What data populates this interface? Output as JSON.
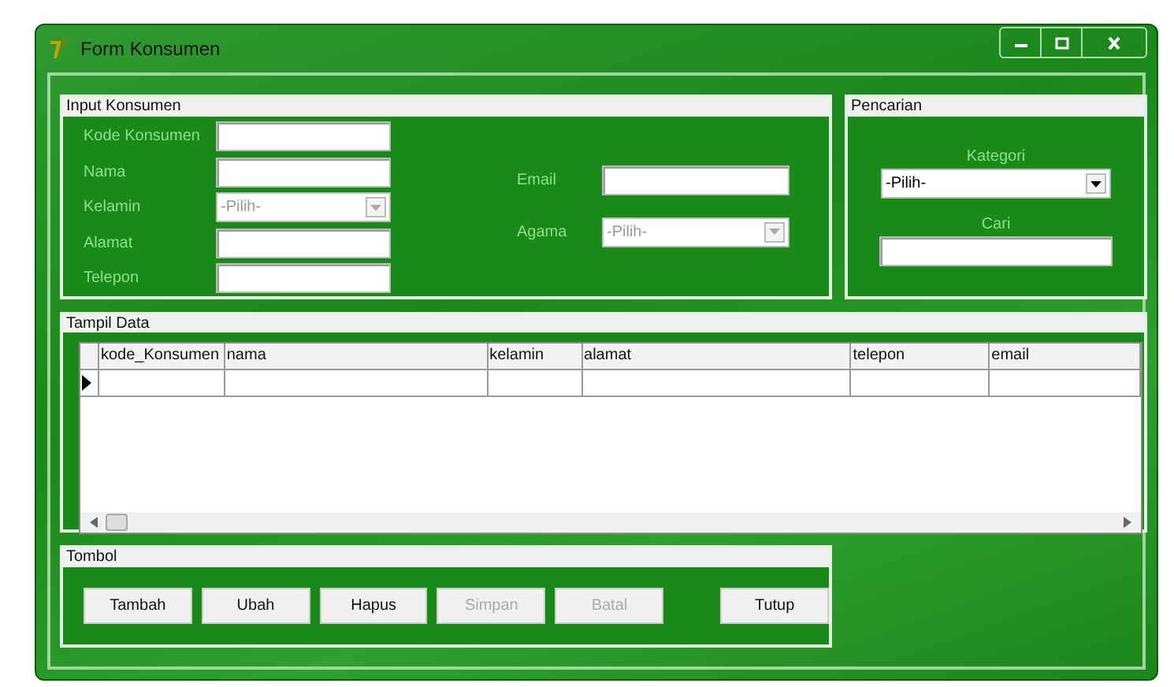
{
  "window": {
    "title": "Form Konsumen"
  },
  "input_group": {
    "title": "Input Konsumen",
    "left_fields": [
      {
        "label": "Kode Konsumen",
        "kind": "text"
      },
      {
        "label": "Nama",
        "kind": "text"
      },
      {
        "label": "Kelamin",
        "kind": "combo",
        "value": "-Pilih-",
        "disabled": true
      },
      {
        "label": "Alamat",
        "kind": "text"
      },
      {
        "label": "Telepon",
        "kind": "text"
      }
    ],
    "right_fields": [
      {
        "label": "Email",
        "kind": "text"
      },
      {
        "label": "Agama",
        "kind": "combo",
        "value": "-Pilih-",
        "disabled": true
      }
    ]
  },
  "search_group": {
    "title": "Pencarian",
    "category_label": "Kategori",
    "category_value": "-Pilih-",
    "search_label": "Cari"
  },
  "data_group": {
    "title": "Tampil Data",
    "columns": [
      "kode_Konsumen",
      "nama",
      "kelamin",
      "alamat",
      "telepon",
      "email"
    ],
    "rows": [
      {
        "current": true
      }
    ]
  },
  "button_group": {
    "title": "Tombol",
    "buttons": [
      {
        "label": "Tambah",
        "disabled": false
      },
      {
        "label": "Ubah",
        "disabled": false
      },
      {
        "label": "Hapus",
        "disabled": false
      },
      {
        "label": "Simpan",
        "disabled": true
      },
      {
        "label": "Batal",
        "disabled": true
      },
      {
        "label": "Tutup",
        "disabled": false,
        "kind": "spaced"
      }
    ]
  }
}
